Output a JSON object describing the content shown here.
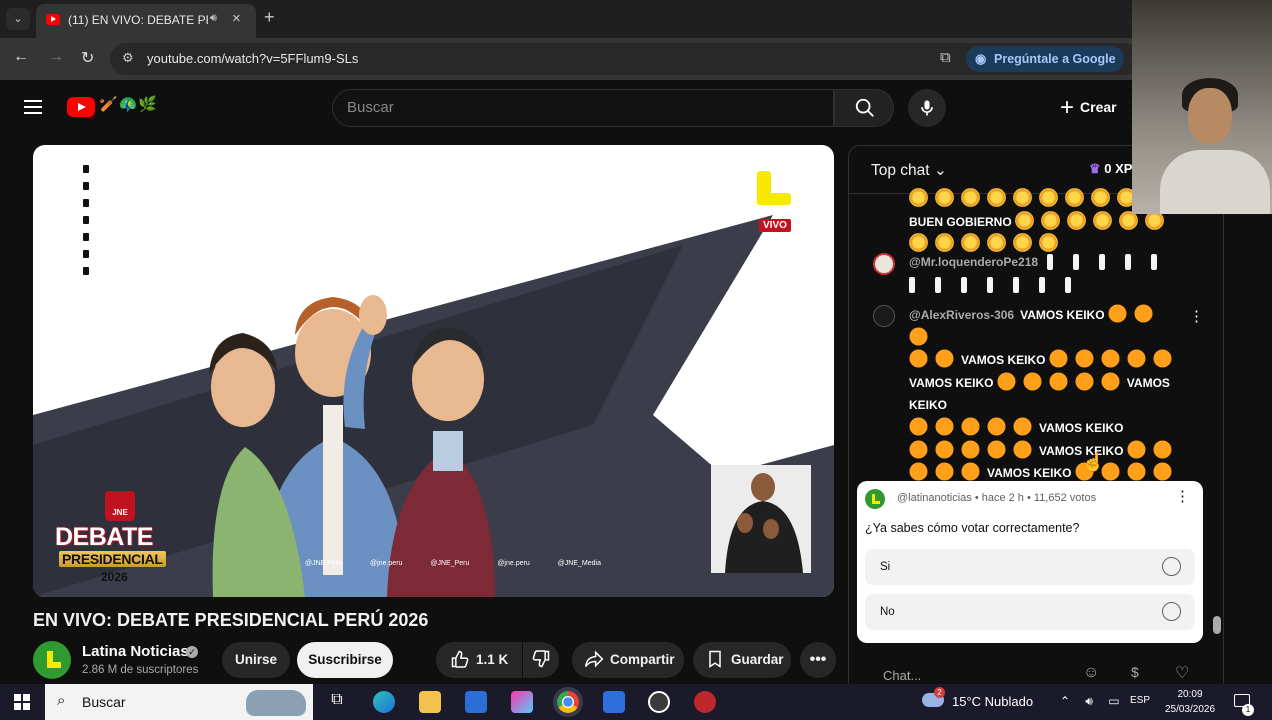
{
  "browser": {
    "tab_title": "(11) EN VIVO: DEBATE PRES",
    "url": "youtube.com/watch?v=5FFlum9-SLs",
    "ask_google_label": "Pregúntale a Google"
  },
  "header": {
    "search_placeholder": "Buscar",
    "create_label": "Crear",
    "logo_doodle": "🏏🦚🌿"
  },
  "player": {
    "live_badge": "VIVO",
    "debate_word": "DEBATE",
    "debate_pres": "PRESIDENCIAL",
    "debate_year": "2026",
    "jne_label": "JNE",
    "social_strip": "@JNE.Peru @jne.peru @JNE_Peru @jne.peru @JNE_Media"
  },
  "video": {
    "title": "EN VIVO: DEBATE PRESIDENCIAL PERÚ 2026",
    "channel_name": "Latina Noticias",
    "subscribers": "2.86 M de suscriptores",
    "join_label": "Unirse",
    "subscribe_label": "Suscribirse",
    "likes": "1.1 K",
    "share_label": "Compartir",
    "save_label": "Guardar"
  },
  "chat": {
    "mode": "Top chat",
    "xp": "0 XP",
    "messages": [
      {
        "author": "",
        "text_a": "BUEN GOBIERNO"
      },
      {
        "author": "@Mr.loquenderoPe218"
      },
      {
        "author": "@AlexRiveros-306",
        "phrase": "VAMOS KEIKO"
      }
    ],
    "poll": {
      "meta": "@latinanoticias • hace 2 h • 11,652 votos",
      "question": "¿Ya sabes cómo votar correctamente?",
      "options": [
        "Si",
        "No"
      ]
    },
    "input_placeholder": "Chat..."
  },
  "taskbar": {
    "search_label": "Buscar",
    "weather": "15°C  Nublado",
    "weather_badge": "2",
    "lang": "ESP",
    "time": "20:09",
    "date": "25/03/2026",
    "notif_count": "1"
  }
}
